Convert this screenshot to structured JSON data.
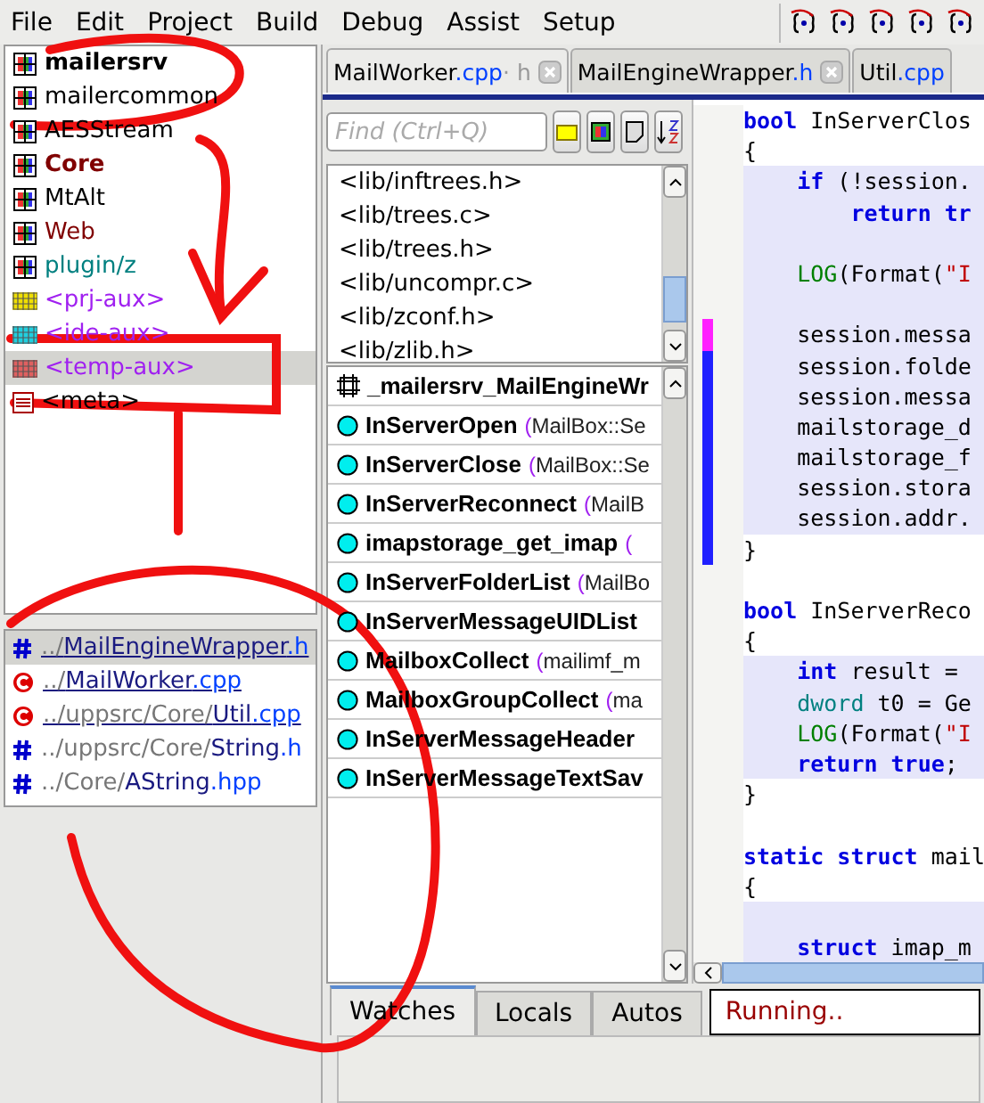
{
  "menu": [
    "File",
    "Edit",
    "Project",
    "Build",
    "Debug",
    "Assist",
    "Setup"
  ],
  "packages": [
    {
      "name": "mailersrv",
      "kind": "package",
      "bold": true,
      "color": "#000000",
      "selected": false
    },
    {
      "name": "mailercommon",
      "kind": "package",
      "bold": false,
      "color": "#000000",
      "selected": false
    },
    {
      "name": "AESStream",
      "kind": "package",
      "bold": false,
      "color": "#000000",
      "selected": false
    },
    {
      "name": "Core",
      "kind": "package",
      "bold": true,
      "color": "#800000",
      "selected": false
    },
    {
      "name": "MtAlt",
      "kind": "package",
      "bold": false,
      "color": "#000000",
      "selected": false
    },
    {
      "name": "Web",
      "kind": "package",
      "bold": false,
      "color": "#800000",
      "selected": false
    },
    {
      "name": "plugin/z",
      "kind": "package",
      "bold": false,
      "color": "#008080",
      "selected": false
    },
    {
      "name": "<prj-aux>",
      "kind": "aux",
      "color": "#f0e000",
      "bold": false,
      "selected": false
    },
    {
      "name": "<ide-aux>",
      "kind": "aux",
      "color": "#20d0e0",
      "bold": false,
      "selected": false
    },
    {
      "name": "<temp-aux>",
      "kind": "aux",
      "color": "#e06060",
      "bold": false,
      "selected": true
    },
    {
      "name": "<meta>",
      "kind": "meta",
      "bold": false,
      "selected": false
    }
  ],
  "files": [
    {
      "dir": "../",
      "name": "MailEngineWrapper",
      "ext": ".h",
      "kind": "header",
      "underlined": true,
      "selected": true
    },
    {
      "dir": "../",
      "name": "MailWorker",
      "ext": ".cpp",
      "kind": "source",
      "underlined": true,
      "selected": false
    },
    {
      "dir": "../uppsrc/Core/",
      "name": "Util",
      "ext": ".cpp",
      "kind": "source",
      "underlined": true,
      "selected": false
    },
    {
      "dir": "../uppsrc/Core/",
      "name": "String",
      "ext": ".h",
      "kind": "header",
      "underlined": false,
      "selected": false
    },
    {
      "dir": "../Core/",
      "name": "AString",
      "ext": ".hpp",
      "kind": "header",
      "underlined": false,
      "selected": false
    }
  ],
  "editor_tabs": [
    {
      "name": "MailWorker",
      "ext": ".cpp",
      "suffix": "· h",
      "closable": true,
      "selected": true
    },
    {
      "name": "MailEngineWrapper",
      "ext": ".h",
      "closable": true,
      "selected": false
    },
    {
      "name": "Util",
      "ext": ".cpp",
      "closable": false,
      "selected": false
    }
  ],
  "find": {
    "placeholder": "Find (Ctrl+Q)"
  },
  "includes": [
    "<lib/inftrees.h>",
    "<lib/trees.c>",
    "<lib/trees.h>",
    "<lib/uncompr.c>",
    "<lib/zconf.h>",
    "<lib/zlib.h>"
  ],
  "symbols": [
    {
      "name": "_mailersrv_MailEngineWr",
      "kind": "macro"
    },
    {
      "name": "InServerOpen",
      "args": "(MailBox::Se",
      "kind": "function"
    },
    {
      "name": "InServerClose",
      "args": "(MailBox::Se",
      "kind": "function"
    },
    {
      "name": "InServerReconnect",
      "args": "(MailB",
      "kind": "function"
    },
    {
      "name": "imapstorage_get_imap",
      "args": "(",
      "kind": "function"
    },
    {
      "name": "InServerFolderList",
      "args": "(MailBo",
      "kind": "function"
    },
    {
      "name": "InServerMessageUIDList",
      "kind": "function"
    },
    {
      "name": "MailboxCollect",
      "args": "(mailimf_m",
      "kind": "function"
    },
    {
      "name": "MailboxGroupCollect",
      "args": "(ma",
      "kind": "function"
    },
    {
      "name": "InServerMessageHeader",
      "kind": "function"
    },
    {
      "name": "InServerMessageTextSav",
      "kind": "function"
    }
  ],
  "code": [
    {
      "block": false,
      "segments": [
        {
          "text": "bool",
          "kind": "keyword"
        },
        {
          "text": " InServerClos",
          "kind": "plain"
        }
      ]
    },
    {
      "block": false,
      "segments": [
        {
          "text": "{",
          "kind": "plain"
        }
      ]
    },
    {
      "block": true,
      "segments": [
        {
          "text": "    if",
          "kind": "keyword"
        },
        {
          "text": " (!session.",
          "kind": "plain"
        }
      ]
    },
    {
      "block": true,
      "segments": [
        {
          "text": "        return tr",
          "kind": "keyword"
        }
      ]
    },
    {
      "block": true
    },
    {
      "block": true,
      "segments": [
        {
          "text": "    LOG",
          "kind": "macro"
        },
        {
          "text": "(Format(",
          "kind": "plain"
        },
        {
          "text": "\"I",
          "kind": "string"
        }
      ]
    },
    {
      "block": true
    },
    {
      "block": true,
      "color": "#ff20ff",
      "segments": [
        {
          "text": "    session.messa",
          "kind": "plain"
        }
      ]
    },
    {
      "block": true,
      "color": "#2020ff",
      "segments": [
        {
          "text": "    session.folde",
          "kind": "plain"
        }
      ]
    },
    {
      "block": true,
      "color": "#2020ff",
      "segments": [
        {
          "text": "    session.messa",
          "kind": "plain"
        }
      ]
    },
    {
      "block": true,
      "color": "#2020ff",
      "segments": [
        {
          "text": "    mailstorage_d",
          "kind": "plain"
        }
      ]
    },
    {
      "block": true,
      "color": "#2020ff",
      "segments": [
        {
          "text": "    mailstorage_f",
          "kind": "plain"
        }
      ]
    },
    {
      "block": true,
      "color": "#2020ff",
      "segments": [
        {
          "text": "    session.stora",
          "kind": "plain"
        }
      ]
    },
    {
      "block": true,
      "color": "#2020ff",
      "segments": [
        {
          "text": "    session.addr.",
          "kind": "plain"
        }
      ]
    },
    {
      "block": false,
      "color": "#2020ff",
      "segments": [
        {
          "text": "}",
          "kind": "plain"
        }
      ]
    },
    {
      "block": false
    },
    {
      "block": false,
      "segments": [
        {
          "text": "bool",
          "kind": "keyword"
        },
        {
          "text": " InServerReco",
          "kind": "plain"
        }
      ]
    },
    {
      "block": false,
      "segments": [
        {
          "text": "{",
          "kind": "plain"
        }
      ]
    },
    {
      "block": true,
      "segments": [
        {
          "text": "    int",
          "kind": "keyword"
        },
        {
          "text": " result =",
          "kind": "plain"
        }
      ]
    },
    {
      "block": true,
      "segments": [
        {
          "text": "    dword",
          "kind": "type"
        },
        {
          "text": " t0 = Ge",
          "kind": "plain"
        }
      ]
    },
    {
      "block": true,
      "segments": [
        {
          "text": "    LOG",
          "kind": "macro"
        },
        {
          "text": "(Format(",
          "kind": "plain"
        },
        {
          "text": "\"I",
          "kind": "string"
        }
      ]
    },
    {
      "block": true,
      "segments": [
        {
          "text": "    return true",
          "kind": "keyword"
        },
        {
          "text": ";",
          "kind": "plain"
        }
      ]
    },
    {
      "block": false,
      "segments": [
        {
          "text": "}",
          "kind": "plain"
        }
      ]
    },
    {
      "block": false
    },
    {
      "block": false,
      "segments": [
        {
          "text": "static struct",
          "kind": "keyword"
        },
        {
          "text": " mail",
          "kind": "plain"
        }
      ]
    },
    {
      "block": false,
      "segments": [
        {
          "text": "{",
          "kind": "plain"
        }
      ]
    },
    {
      "block": true
    },
    {
      "block": true,
      "segments": [
        {
          "text": "    struct",
          "kind": "keyword"
        },
        {
          "text": " imap_m",
          "kind": "plain"
        }
      ]
    }
  ],
  "bottom_tabs": [
    {
      "label": "Watches",
      "selected": true
    },
    {
      "label": "Locals",
      "selected": false
    },
    {
      "label": "Autos",
      "selected": false
    }
  ],
  "status": "Running.."
}
